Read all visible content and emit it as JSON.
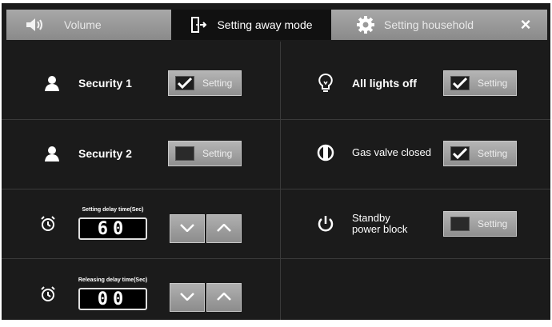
{
  "tabs": {
    "volume": {
      "label": "Volume",
      "icon": "speaker-icon"
    },
    "away": {
      "label": "Setting away mode",
      "icon": "door-exit-icon"
    },
    "household": {
      "label": "Setting household",
      "icon": "gear-icon"
    },
    "close": {
      "label": "×",
      "icon": "close-icon"
    }
  },
  "left": {
    "security1": {
      "label": "Security 1",
      "setting_label": "Setting",
      "checked": true,
      "icon": "person-icon"
    },
    "security2": {
      "label": "Security 2",
      "setting_label": "Setting",
      "checked": false,
      "icon": "person-icon"
    },
    "setting_delay": {
      "caption": "Setting delay time(Sec)",
      "value": "60",
      "icon": "alarm-clock-icon"
    },
    "releasing_delay": {
      "caption": "Releasing delay time(Sec)",
      "value": "00",
      "icon": "alarm-clock-icon"
    }
  },
  "right": {
    "lights": {
      "label": "All lights off",
      "setting_label": "Setting",
      "checked": true,
      "icon": "light-bulb-icon"
    },
    "gas": {
      "label": "Gas valve closed",
      "setting_label": "Setting",
      "checked": true,
      "icon": "gas-valve-icon"
    },
    "standby": {
      "label_line1": "Standby",
      "label_line2": "power block",
      "setting_label": "Setting",
      "checked": false,
      "icon": "power-icon"
    }
  },
  "colors": {
    "background": "#1b1b1b",
    "tab_inactive": "#9a9a9a",
    "button": "#a0a0a0"
  }
}
